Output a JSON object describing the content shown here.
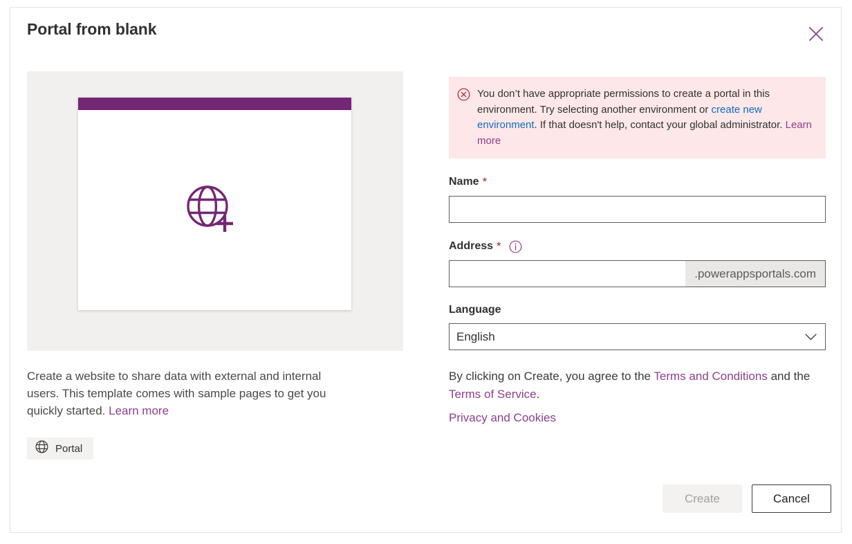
{
  "dialog": {
    "title": "Portal from blank",
    "close_icon": "close-icon"
  },
  "preview": {
    "card_icon": "globe-plus-icon",
    "bar_color": "#742774",
    "icon_color": "#742774",
    "panel_color": "#f1f0ef",
    "description_prefix": "Create a website to share data with external and internal users. This template comes with sample pages to get you quickly started. ",
    "learn_more": "Learn more",
    "tag": {
      "icon": "globe-icon",
      "label": "Portal"
    }
  },
  "error": {
    "icon": "error-circle-x-icon",
    "text_part1": "You don’t have appropriate permissions to create a portal in this environment. Try selecting another environment or ",
    "link_environment": "create new environment",
    "text_part2": ". If that doesn't help, contact your global administrator. ",
    "learn_more": "Learn more",
    "background": "#fde7e9",
    "link_color": "#0f6cbd",
    "icon_color": "#a4262c"
  },
  "form": {
    "name": {
      "label": "Name",
      "required_marker": "*",
      "value": "",
      "placeholder": ""
    },
    "address": {
      "label": "Address",
      "required_marker": "*",
      "info_icon": "info-icon",
      "value": "",
      "placeholder": "",
      "suffix": ".powerappsportals.com"
    },
    "language": {
      "label": "Language",
      "selected": "English",
      "chevron_icon": "chevron-down-icon"
    }
  },
  "legal": {
    "text_prefix": "By clicking on Create, you agree to the ",
    "terms_conditions": "Terms and Conditions",
    "text_middle": " and the ",
    "terms_of_service": "Terms of Service",
    "text_suffix": ".",
    "privacy_cookies": "Privacy and Cookies",
    "link_color": "#8d3f8d"
  },
  "footer": {
    "create_label": "Create",
    "cancel_label": "Cancel"
  }
}
